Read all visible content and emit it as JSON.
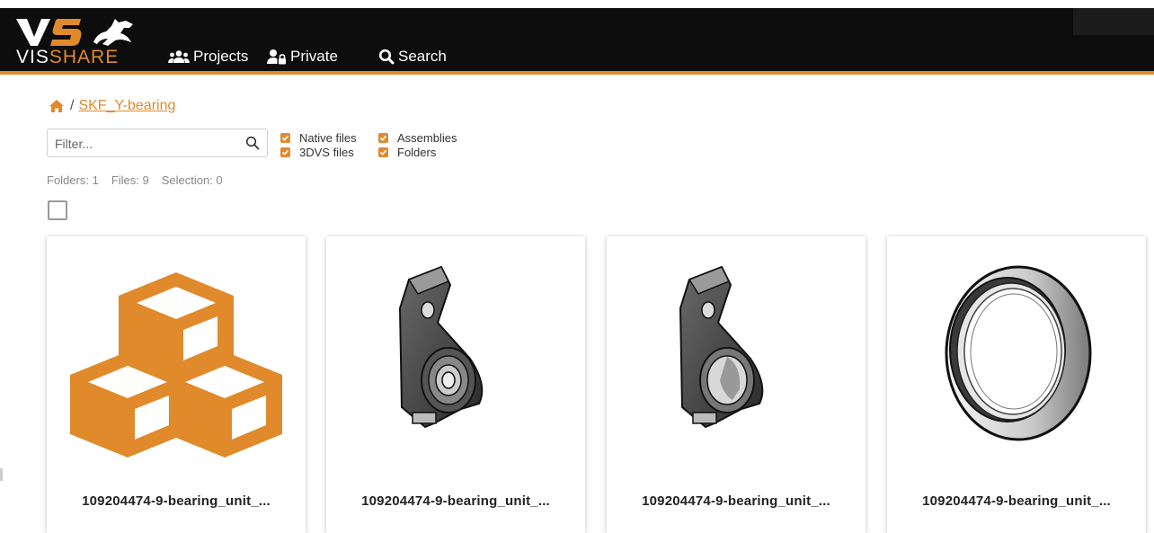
{
  "app": {
    "logo_top": "VS",
    "logo_bottom_a": "VIS",
    "logo_bottom_b": "SHARE",
    "accent_color": "#e08a2c",
    "topbar_color": "#0d0d0d"
  },
  "nav": {
    "projects": {
      "label": "Projects",
      "icon": "users-icon"
    },
    "private": {
      "label": "Private",
      "icon": "user-lock-icon"
    },
    "search": {
      "label": "Search",
      "icon": "search-icon"
    }
  },
  "breadcrumb": {
    "home_icon": "home-icon",
    "separator": "/",
    "current": "SKF_Y-bearing"
  },
  "filter": {
    "placeholder": "Filter...",
    "value": "",
    "options": [
      {
        "label": "Native files",
        "checked": true
      },
      {
        "label": "3DVS files",
        "checked": true
      },
      {
        "label": "Assemblies",
        "checked": true
      },
      {
        "label": "Folders",
        "checked": true
      }
    ]
  },
  "counts": {
    "folders": "Folders: 1",
    "files": "Files: 9",
    "selection": "Selection: 0"
  },
  "select_all": {
    "checked": false
  },
  "cards": [
    {
      "name": "109204474-9-bearing_unit_...",
      "thumbnail": "assembly-icon"
    },
    {
      "name": "109204474-9-bearing_unit_...",
      "thumbnail": "bearing-housing-render"
    },
    {
      "name": "109204474-9-bearing_unit_...",
      "thumbnail": "bearing-housing-cut-render"
    },
    {
      "name": "109204474-9-bearing_unit_...",
      "thumbnail": "bearing-ring-render"
    }
  ]
}
